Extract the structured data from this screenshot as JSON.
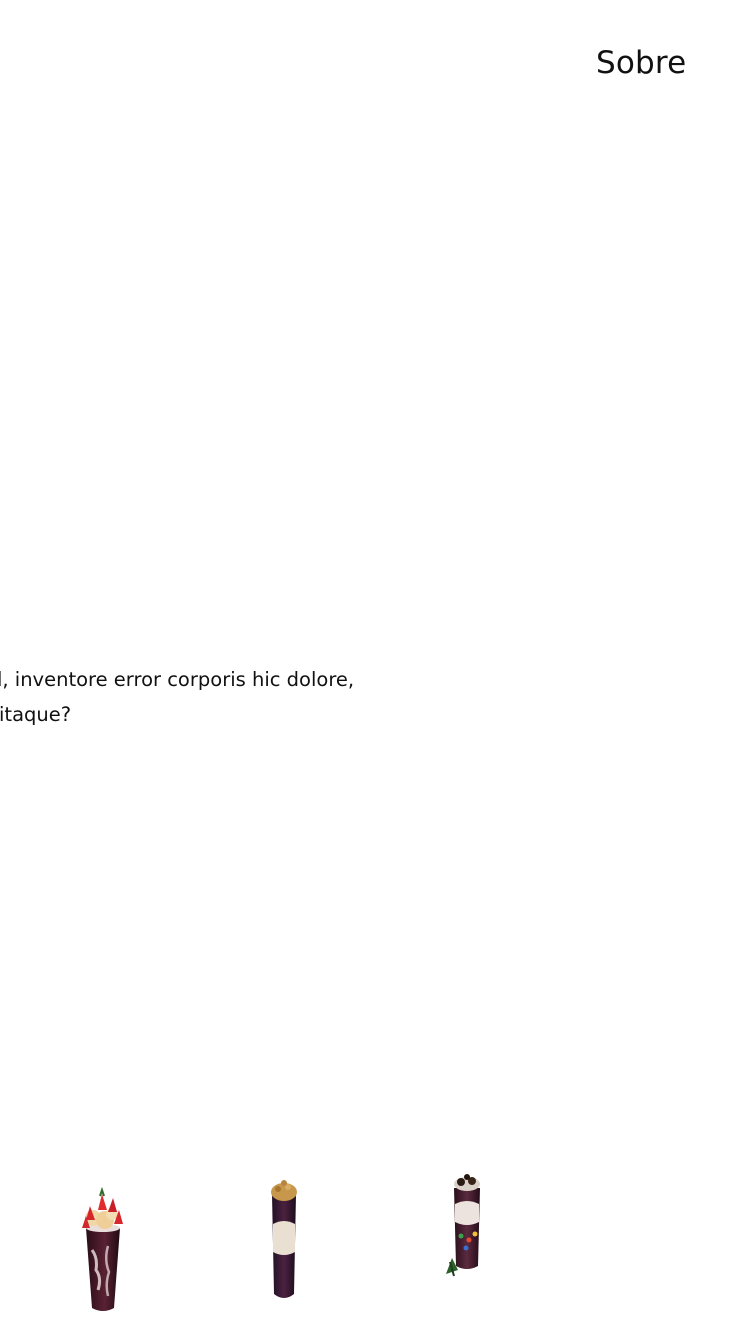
{
  "nav": {
    "items": [
      {
        "label": "Sobre"
      }
    ]
  },
  "hero": {
    "lines": [
      "d, inventore error corporis hic dolore,",
      "itaque?"
    ]
  },
  "products": [
    {
      "name": "strawberry-acai-cup",
      "color": "#3a1220"
    },
    {
      "name": "granola-acai-cup",
      "color": "#2f1425"
    },
    {
      "name": "chocolate-cookie-acai-cup",
      "color": "#3b1a2c"
    }
  ]
}
